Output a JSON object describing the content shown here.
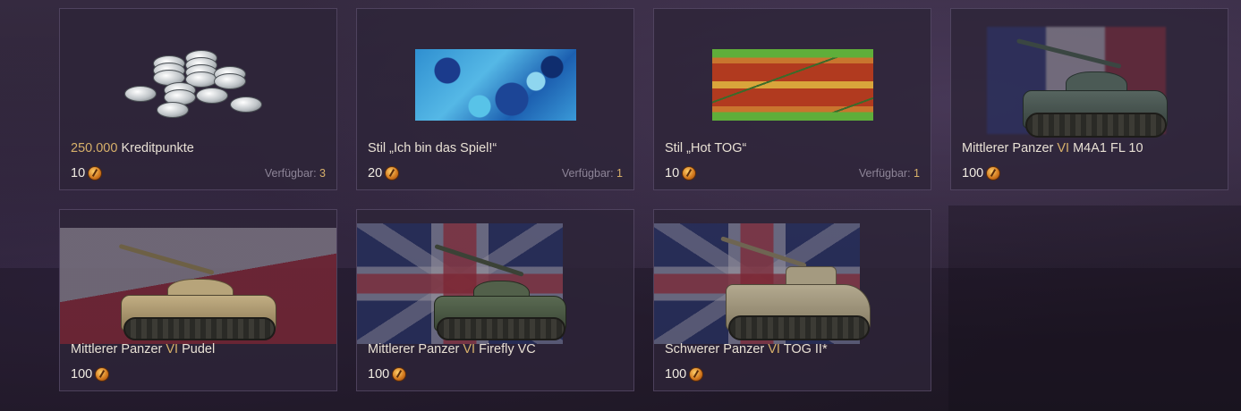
{
  "cards": [
    {
      "type": "credits",
      "title_accent": "250.000",
      "title_rest": " Kreditpunkte",
      "price": "10",
      "available_label": "Verfügbar:",
      "available_count": "3",
      "icon": "silver-coins-icon"
    },
    {
      "type": "style",
      "title_plain": "Stil „Ich bin das Spiel!“",
      "price": "20",
      "available_label": "Verfügbar:",
      "available_count": "1",
      "icon": "camo-gamepad-icon"
    },
    {
      "type": "style",
      "title_plain": "Stil „Hot TOG“",
      "price": "10",
      "available_label": "Verfügbar:",
      "available_count": "1",
      "icon": "camo-hotdog-icon"
    },
    {
      "type": "tank",
      "title_prefix": "Mittlerer Panzer ",
      "tier": "VI",
      "title_name": " M4A1 FL 10",
      "price": "100",
      "icon": "tank-icon"
    },
    {
      "type": "tank",
      "title_prefix": "Mittlerer Panzer ",
      "tier": "VI",
      "title_name": " Pudel",
      "price": "100",
      "icon": "tank-icon"
    },
    {
      "type": "tank",
      "title_prefix": "Mittlerer Panzer ",
      "tier": "VI",
      "title_name": " Firefly VC",
      "price": "100",
      "icon": "tank-icon"
    },
    {
      "type": "tank",
      "title_prefix": "Schwerer Panzer ",
      "tier": "VI",
      "title_name": " TOG II*",
      "price": "100",
      "icon": "tank-icon"
    }
  ],
  "colors": {
    "accent_gold": "#d7b06a",
    "text": "#e8e0d4",
    "muted": "#8d8497",
    "card_bg": "#2d2438"
  },
  "currency_icon": "gold-coin-icon"
}
